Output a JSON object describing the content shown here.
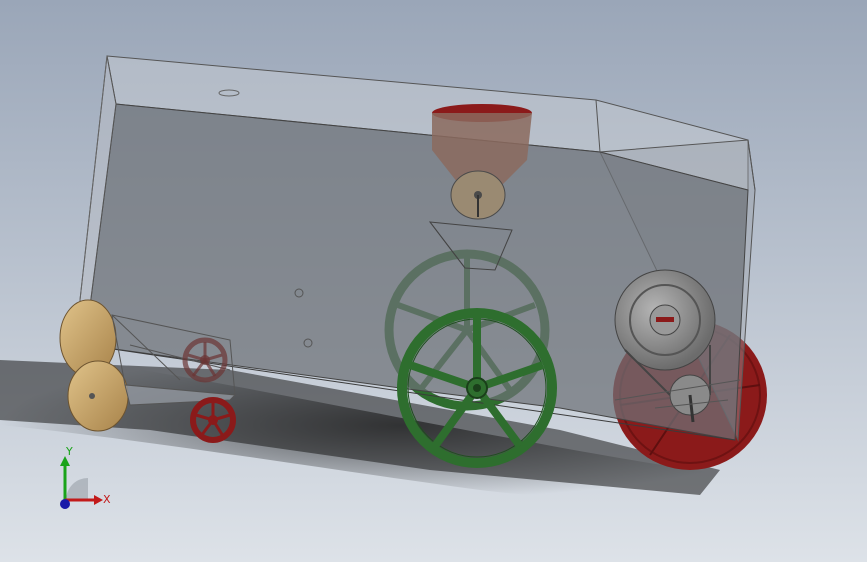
{
  "triad": {
    "x_label": "X",
    "y_label": "Y",
    "x_color": "#c21a1a",
    "y_color": "#19a319",
    "z_color": "#1a1aa8"
  },
  "model": {
    "housing_color": "#8a8f95",
    "wheel_color": "#2e6e2e",
    "rear_wheel_color": "#8b1a1a",
    "hopper_color": "#8b1a1a",
    "pulley_color": "#8e8e8e",
    "disc_color": "#c9a66b"
  }
}
